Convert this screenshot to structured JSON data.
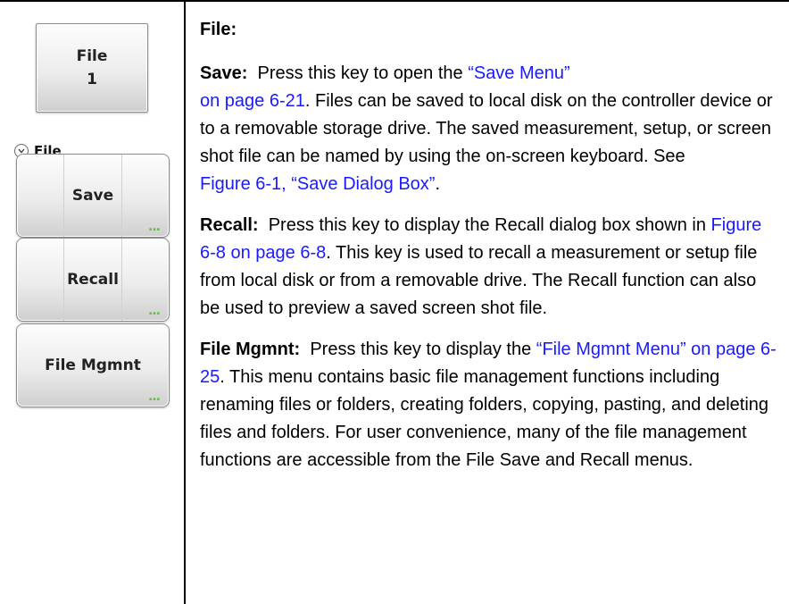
{
  "sidebar": {
    "main_key": {
      "line1": "File",
      "line2": "1"
    },
    "group_label": "File",
    "keys": [
      {
        "label": "Save",
        "more": "..."
      },
      {
        "label": "Recall",
        "more": "..."
      },
      {
        "label": "File Mgmnt",
        "more": "..."
      }
    ]
  },
  "content": {
    "heading": "File:",
    "save": {
      "label": "Save:",
      "text1": "Press this key to open the ",
      "link1": "“Save Menu”",
      "link2": "on page 6-21",
      "text2": ". Files can be saved to local disk on the controller device or to a removable storage drive. The saved measurement, setup, or screen shot file can be named by using the on-screen keyboard. See ",
      "link3": "Figure 6-1, “Save Dialog Box”",
      "text3": "."
    },
    "recall": {
      "label": "Recall:",
      "text1": "Press this key to display the Recall dialog box shown in ",
      "link1": "Figure 6-8 on page 6-8",
      "text2": ". This key is used to recall a measurement or setup file from local disk or from a removable drive. The Recall function can also be used to preview a saved screen shot file."
    },
    "file_mgmnt": {
      "label": "File Mgmnt:",
      "text1": "Press this key to display the ",
      "link1": "“File Mgmnt Menu” on page 6-25",
      "text2": ". This menu contains basic file management functions including renaming files or folders, creating folders, copying, pasting, and deleting files and folders. For user convenience, many of the file management functions are accessible from the File Save and Recall menus."
    }
  }
}
